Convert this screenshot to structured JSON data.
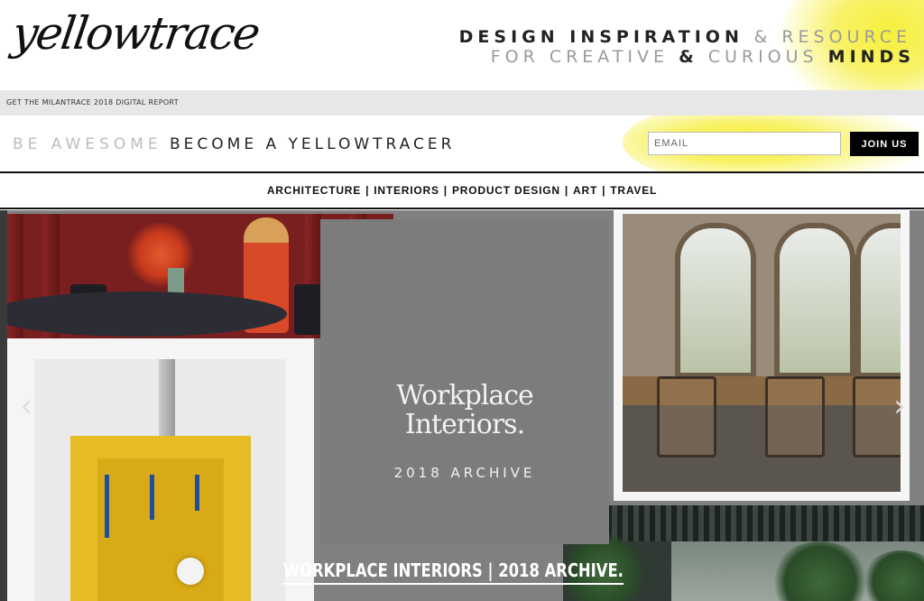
{
  "header": {
    "logo_text": "yellowtrace",
    "tagline_line1_bold": "DESIGN INSPIRATION",
    "tagline_line1_light": "& RESOURCE",
    "tagline_line2_light": "FOR CREATIVE",
    "tagline_line2_amp": "&",
    "tagline_line2_light2": "CURIOUS",
    "tagline_line2_bold": "MINDS"
  },
  "promo_bar": {
    "link_text": "GET THE MILANTRACE 2018 DIGITAL REPORT"
  },
  "signup": {
    "be_awesome": "BE AWESOME",
    "become": "BECOME A YELLOWTRACER",
    "email_placeholder": "EMAIL",
    "join_label": "JOIN US"
  },
  "nav": {
    "items": [
      "ARCHITECTURE",
      "INTERIORS",
      "PRODUCT DESIGN",
      "ART",
      "TRAVEL"
    ],
    "separator": "|"
  },
  "hero": {
    "brand_line1": "Workplace",
    "brand_line2": "Interiors.",
    "brand_subtitle": "2018 ARCHIVE",
    "caption": "WORKPLACE INTERIORS | 2018 ARCHIVE.",
    "prev_icon": "chevron-left-icon",
    "next_icon": "chevron-right-icon"
  },
  "colors": {
    "accent_yellow": "#f5ec2e",
    "hero_grey": "#808080",
    "text_dark": "#111111"
  }
}
